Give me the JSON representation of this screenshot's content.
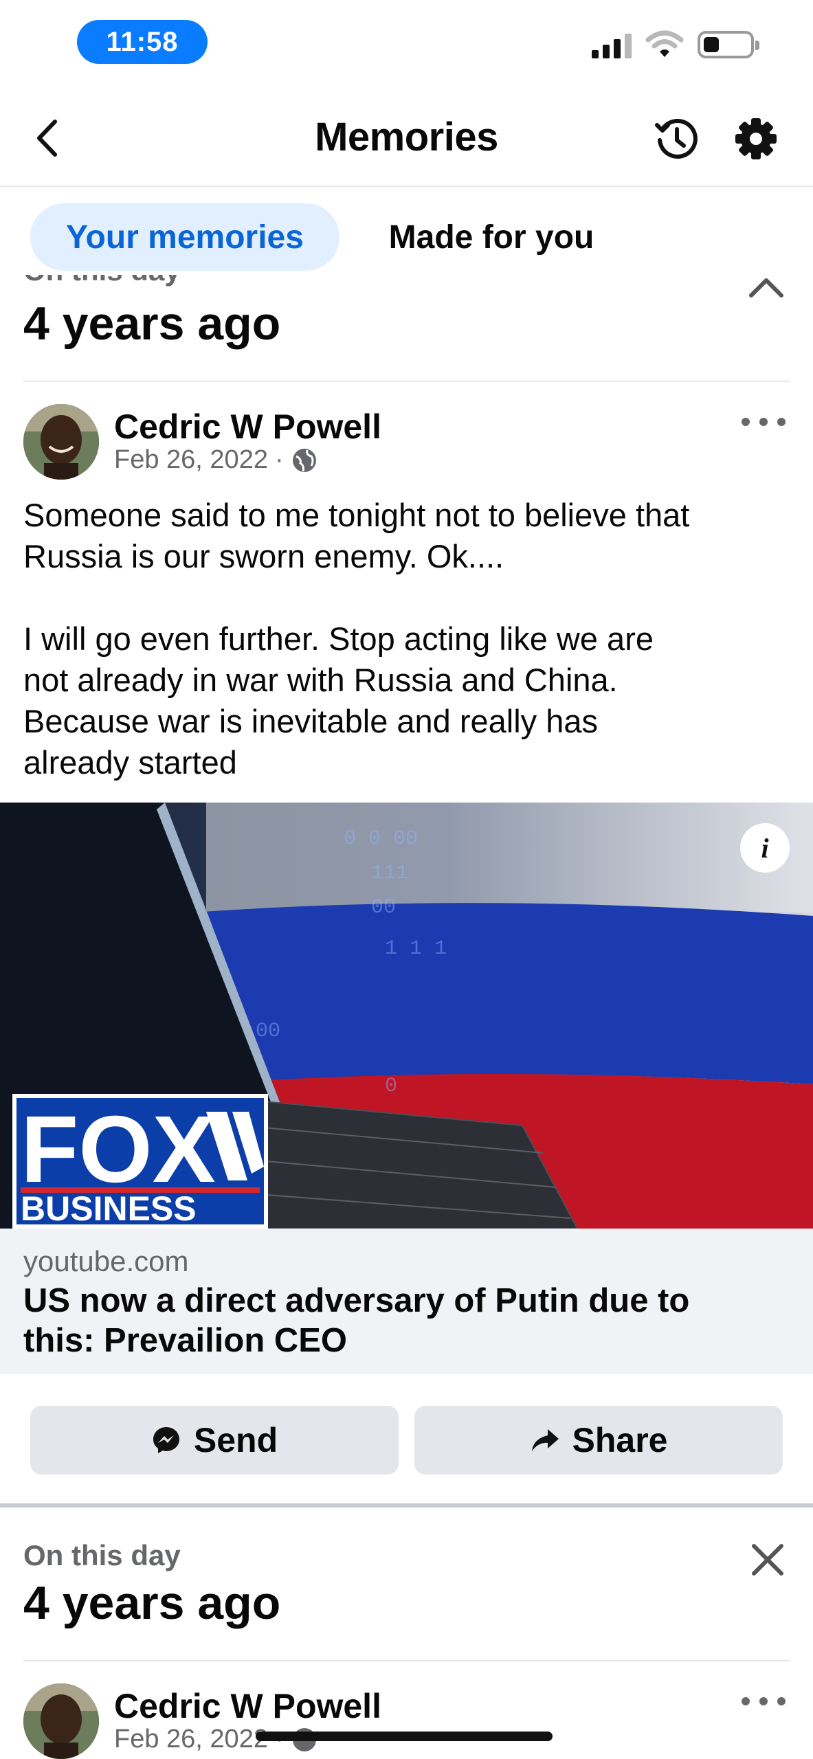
{
  "status_bar": {
    "time": "11:58"
  },
  "header": {
    "title": "Memories"
  },
  "tabs": [
    {
      "label": "Your memories",
      "active": true
    },
    {
      "label": "Made for you",
      "active": false
    }
  ],
  "memories": [
    {
      "kicker": "On this day",
      "ago": "4 years ago",
      "post": {
        "author": "Cedric W Powell",
        "date": "Feb 26, 2022",
        "audience_icon": "globe-icon",
        "text_lines": [
          "Someone said to me tonight not to believe that",
          "Russia is our sworn enemy. Ok....",
          "",
          "I will go even further. Stop acting like we are",
          "not already in war with Russia and China.",
          "Because war is inevitable and really has",
          "already started"
        ],
        "link": {
          "logo_line1": "FOX",
          "logo_line2": "BUSINESS",
          "domain": "youtube.com",
          "title_line1": "US now a direct adversary of Putin due to",
          "title_line2": "this: Prevailion CEO"
        }
      },
      "actions": {
        "send": "Send",
        "share": "Share"
      }
    },
    {
      "kicker": "On this day",
      "ago": "4 years ago",
      "post": {
        "author": "Cedric W Powell",
        "date": "Feb 26, 2022",
        "audience_icon": "globe-icon"
      }
    }
  ],
  "colors": {
    "accent": "#0a66d6",
    "accent_bg": "#e2efff",
    "status_pill": "#0a7cff",
    "muted": "#65676b",
    "button_bg": "#e4e6eb"
  }
}
